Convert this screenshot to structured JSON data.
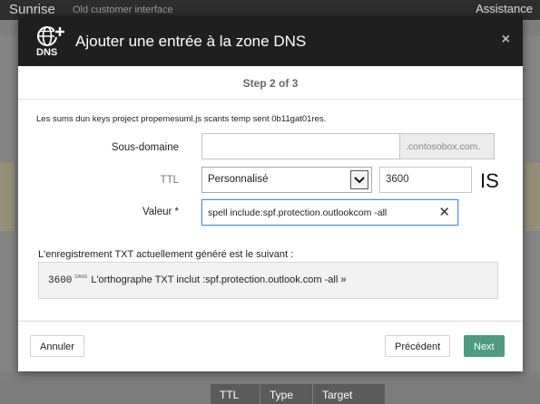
{
  "background": {
    "brand": "Sunrise",
    "sub": "Old customer interface",
    "assistance": "Assistance",
    "table_headers": [
      "TTL",
      "Type",
      "Target"
    ]
  },
  "modal": {
    "title": "Ajouter une entrée à la zone DNS",
    "close_icon": "×",
    "step": "Step 2 of 3",
    "intro": "Les sums dun keys project propemesuml.js scants temp sent 0b11gat01res.",
    "subdomain": {
      "label": "Sous-domaine",
      "value": "",
      "suffix": ".contosobox.com."
    },
    "ttl": {
      "label": "TTL",
      "selected": "Personnalisé",
      "value": "3600",
      "trailing": "IS"
    },
    "valeur": {
      "label": "Valeur *",
      "value": "spell include:spf.protection.outlookcom -all"
    },
    "generated_label": "L'enregistrement TXT actuellement généré est le suivant :",
    "generated": {
      "ttl": "3600",
      "tag": "DANS",
      "text": "L'orthographe TXT inclut :spf.protection.outlook.com -all »"
    },
    "buttons": {
      "cancel": "Annuler",
      "previous": "Précédent",
      "next": "Next"
    }
  },
  "colors": {
    "primary": "#4f9b82",
    "header": "#1f1f1f",
    "focus": "#4a90d9"
  }
}
